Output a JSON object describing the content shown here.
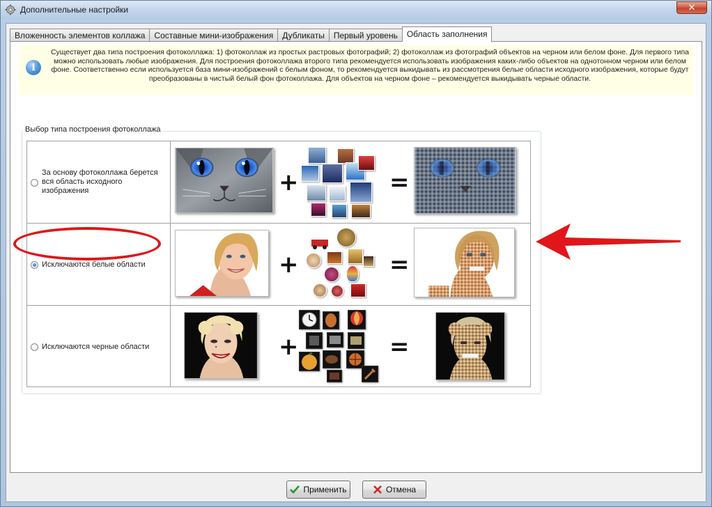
{
  "window": {
    "title": "Дополнительные настройки",
    "close_label": "✕"
  },
  "tabs": [
    {
      "label": "Вложенность элементов коллажа",
      "active": false
    },
    {
      "label": "Составные мини-изображения",
      "active": false
    },
    {
      "label": "Дубликаты",
      "active": false
    },
    {
      "label": "Первый уровень",
      "active": false
    },
    {
      "label": "Область заполнения",
      "active": true
    }
  ],
  "info": {
    "text": "Существует два типа построения фотоколлажа: 1) фотоколлаж из простых растровых фотографий; 2) фотоколлаж из фотографий объектов на черном или белом фоне. Для первого типа можно использовать любые изображения. Для построения фотоколлажа второго типа рекомендуется использовать изображения каких-либо объектов на однотонном черном или белом фоне. Соответственно если используется база мини-изображений с белым фоном, то рекомендуется выкидывать из рассмотрения белые области исходного изображения, которые будут преобразованы в чистый белый фон фотоколлажа. Для объектов на черном фоне – рекомендуется выкидывать черные области."
  },
  "group": {
    "title": "Выбор типа построения фотоколлажа",
    "options": [
      {
        "label": "За основу фотоколлажа берется вся область исходного изображения",
        "checked": false
      },
      {
        "label": "Исключаются белые области",
        "checked": true
      },
      {
        "label": "Исключаются черные области",
        "checked": false
      }
    ],
    "plus": "+",
    "equals": "="
  },
  "buttons": {
    "apply": "Применить",
    "cancel": "Отмена"
  },
  "colors": {
    "highlight": "#e0161a",
    "accent": "#1f62b0"
  }
}
